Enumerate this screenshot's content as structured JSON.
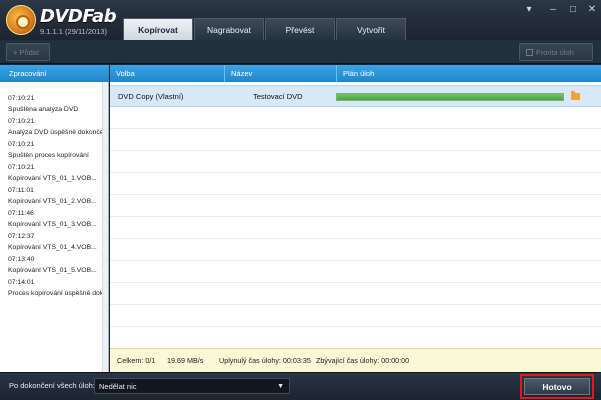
{
  "app": {
    "brand": "DVDFab",
    "version": "9.1.1.1 (29/11/2013)"
  },
  "tabs": [
    {
      "label": "Kopírovat",
      "active": true
    },
    {
      "label": "Nagrabovat",
      "active": false
    },
    {
      "label": "Převést",
      "active": false
    },
    {
      "label": "Vytvořit",
      "active": false
    }
  ],
  "toolbar": {
    "add_label": "+ Přidat",
    "queue_label": "Fronta úloh"
  },
  "left_panel": {
    "header": "Zpracování",
    "log": [
      "07:10:21",
      "Spuštěna analýza DVD",
      "07:10:21",
      "Analýza DVD úspěšně dokončena",
      "07:10:21",
      "Spuštěn proces kopírování",
      "07:10:21",
      "Kopírování VTS_01_1.VOB...",
      "07:11:01",
      "Kopírování VTS_01_2.VOB...",
      "07:11:46",
      "Kopírování VTS_01_3.VOB...",
      "07:12:37",
      "Kopírování VTS_01_4.VOB...",
      "07:13:40",
      "Kopírování VTS_01_5.VOB...",
      "07:14:01",
      "Proces kopírování úspěšně dokončen"
    ]
  },
  "table": {
    "columns": [
      "Volba",
      "Název",
      "Plán úloh"
    ],
    "rows": [
      {
        "option": "DVD Copy (Vlastní)",
        "name": "Testovací DVD",
        "progress": 1.0
      }
    ]
  },
  "status": {
    "total": "Celkem: 0/1",
    "speed": "19.69 MB/s",
    "elapsed": "Uplynulý čas úlohy: 00:03:35",
    "remaining": "Zbývající čas úlohy: 00:00:00"
  },
  "bottom": {
    "after_label": "Po dokončení všech úloh:",
    "after_value": "Nedělat nic",
    "done_label": "Hotovo"
  },
  "colors": {
    "header_blue": "#2293d9",
    "progress_green": "#5bb55a",
    "highlight_red": "#e5171e"
  }
}
